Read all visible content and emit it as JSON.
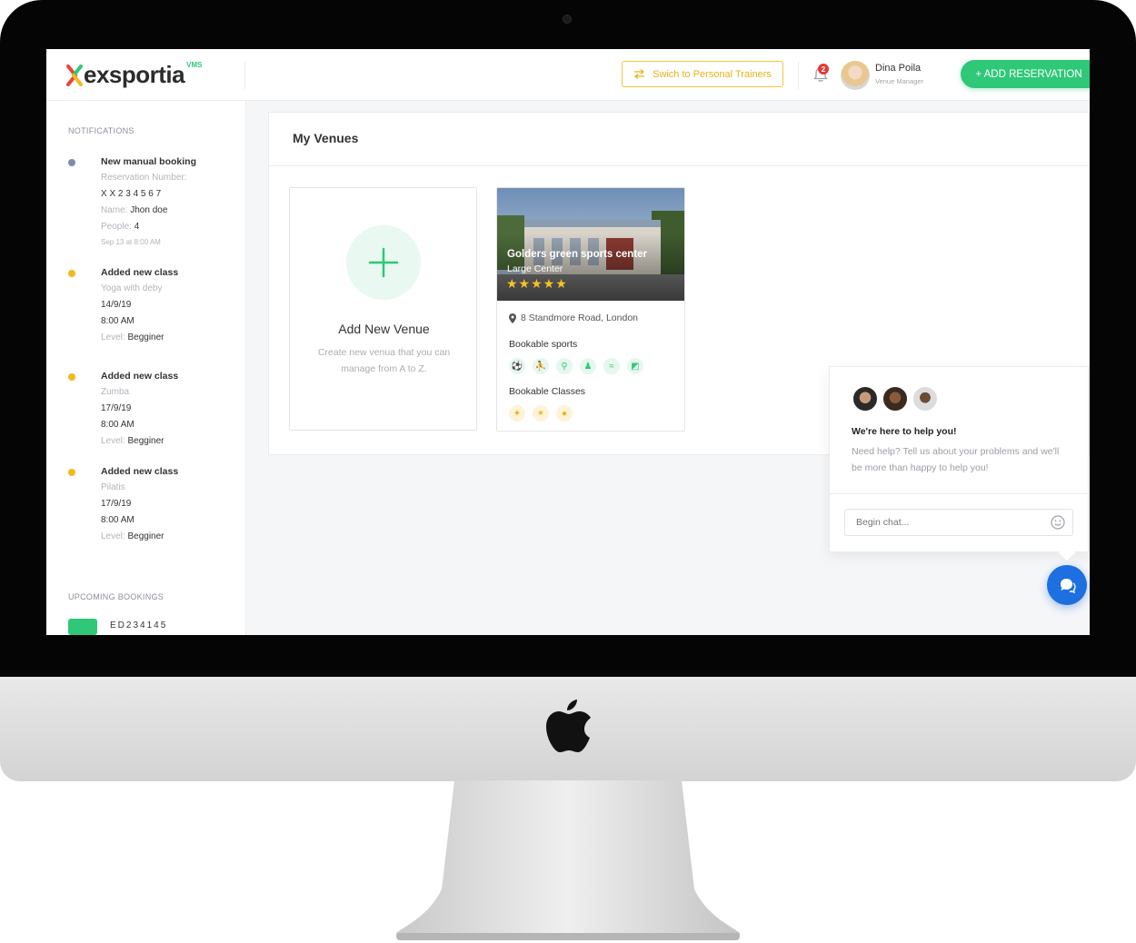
{
  "app": {
    "logo_text": "exsportia",
    "logo_badge": "VMS"
  },
  "topbar": {
    "switch_label": "Swich to Personal Trainers",
    "notification_count": "2",
    "user_name": "Dina Poila",
    "user_role": "Venue Manager",
    "add_reservation_label": "+ ADD RESERVATION"
  },
  "sidebar": {
    "notifications_title": "NOTIFICATIONS",
    "notifications": [
      {
        "title": "New manual booking",
        "color": "#7b8db0",
        "reservation_label": "Reservation Number:",
        "reservation_value": "X X 2 3 4 5 6 7",
        "name_label": "Name: ",
        "name_value": "Jhon doe",
        "people_label": "People: ",
        "people_value": "4",
        "time": "Sep 13 at 8:00 AM"
      },
      {
        "title": "Added new class",
        "color": "#f5b81b",
        "class_name": "Yoga with deby",
        "date": "14/9/19",
        "time": "8:00 AM",
        "level_label": "Level: ",
        "level_value": "Begginer"
      },
      {
        "title": "Added new class",
        "color": "#f5b81b",
        "class_name": "Zumba",
        "date": "17/9/19",
        "time": "8:00 AM",
        "level_label": "Level: ",
        "level_value": "Begginer"
      },
      {
        "title": "Added new class",
        "color": "#f5b81b",
        "class_name": "Pilatis",
        "date": "17/9/19",
        "time": "8:00 AM",
        "level_label": "Level: ",
        "level_value": "Begginer"
      }
    ],
    "upcoming_title": "UPCOMING BOOKINGS",
    "upcoming_code": "ED234145"
  },
  "main": {
    "title": "My Venues",
    "add_venue": {
      "title": "Add New Venue",
      "description": "Create new venua that you can manage from A to Z."
    },
    "venue": {
      "name": "Golders green sports center",
      "type": "Large Center",
      "stars": "★★★★★",
      "rating": 5,
      "address": "8 Standmore Road, London",
      "sports_label": "Bookable sports",
      "sports_icons": [
        "football-icon",
        "basketball-icon",
        "tennis-icon",
        "bowling-icon",
        "swimming-icon",
        "squash-icon"
      ],
      "classes_label": "Bookable Classes",
      "classes_icons": [
        "yoga-icon",
        "dance-icon",
        "fitness-icon"
      ]
    }
  },
  "chat": {
    "title": "We're here to help you!",
    "description": "Need help? Tell us about your problems and we'll be more than happy to help you!",
    "placeholder": "Begin chat..."
  },
  "colors": {
    "accent_green": "#2ec878",
    "accent_yellow": "#f5c542",
    "chat_blue": "#1e6fe0",
    "notification_red": "#e53935"
  }
}
